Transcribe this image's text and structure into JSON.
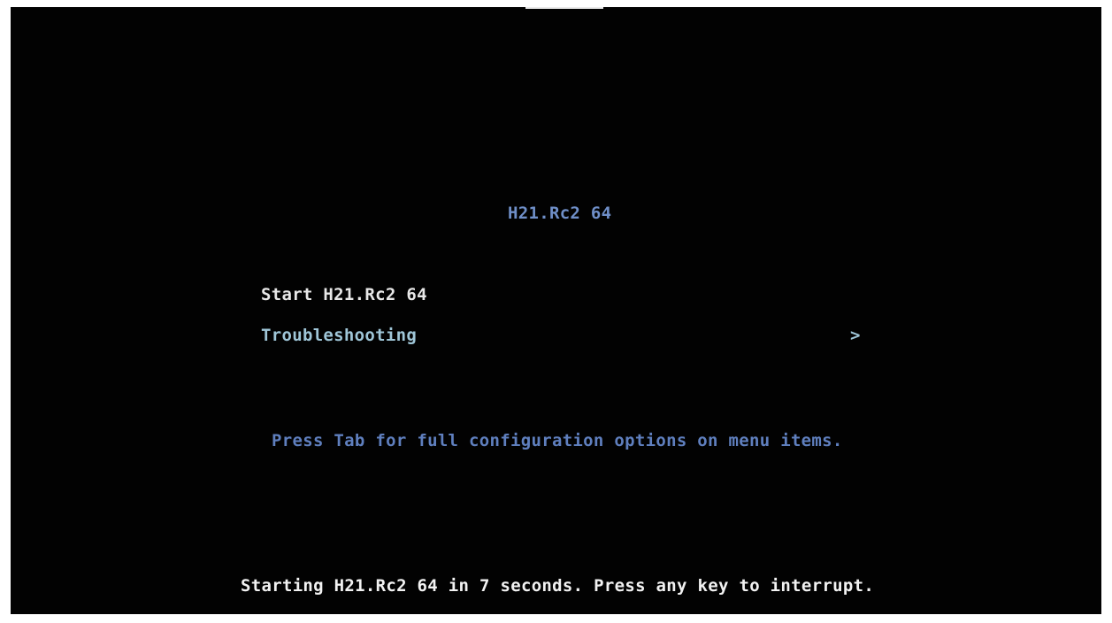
{
  "boot_menu": {
    "title": "H21.Rc2 64",
    "items": [
      {
        "label": "Start H21.Rc2 64",
        "has_submenu": false,
        "selected": true
      },
      {
        "label": "Troubleshooting",
        "has_submenu": true,
        "submenu_glyph": ">"
      }
    ],
    "hint": "Press Tab for full configuration options on menu items.",
    "countdown": "Starting H21.Rc2 64 in 7 seconds. Press any key to interrupt."
  },
  "colors": {
    "background": "#020202",
    "title": "#6f8fc8",
    "selected_item": "#e8e8e8",
    "item": "#9fc6d8",
    "hint": "#5f7fbe",
    "countdown": "#f2f2f2"
  }
}
